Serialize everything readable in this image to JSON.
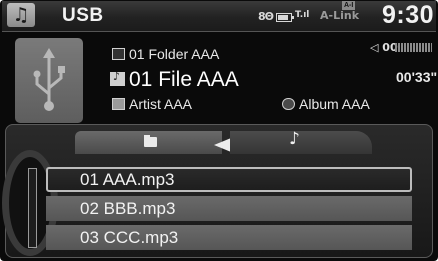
{
  "status_bar": {
    "source_label": "USB",
    "source_icon": "music-note-icon",
    "bluetooth_text": "8Θ",
    "signal_text": "T.ıl",
    "alink_label": "A-Link",
    "alink_badge": "A-I",
    "clock": "9:30"
  },
  "now_playing": {
    "folder": "01 Folder AAA",
    "file": "01 File AAA",
    "artist": "Artist AAA",
    "album": "Album AAA",
    "volume_label": "◁ 00",
    "elapsed": "00'33\""
  },
  "tabs": {
    "active": "music",
    "items": [
      {
        "id": "folder",
        "icon": "folder-icon"
      },
      {
        "id": "music",
        "icon": "music-note-icon"
      }
    ]
  },
  "track_list": {
    "selected_index": 0,
    "items": [
      "01 AAA.mp3",
      "02 BBB.mp3",
      "03 CCC.mp3"
    ]
  },
  "colors": {
    "background": "#0a0a0a",
    "row_fill": "#5e5e5e",
    "selected_border": "#bcbcbc",
    "text": "#f2f2f2"
  }
}
